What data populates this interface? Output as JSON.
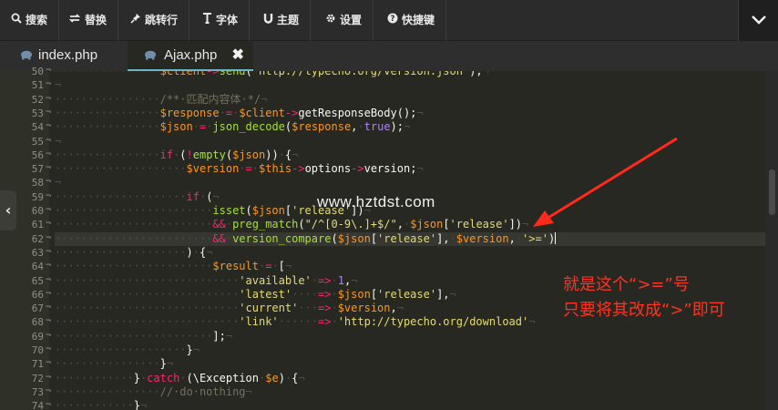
{
  "toolbar": {
    "buttons": [
      {
        "id": "search",
        "icon": "search-icon",
        "label": "搜索"
      },
      {
        "id": "replace",
        "icon": "replace-icon",
        "label": "替换"
      },
      {
        "id": "goto",
        "icon": "pin-icon",
        "label": "跳转行"
      },
      {
        "id": "font",
        "icon": "text-icon",
        "label": "字体"
      },
      {
        "id": "theme",
        "icon": "magnet-icon",
        "label": "主题"
      },
      {
        "id": "settings",
        "icon": "gear-icon",
        "label": "设置"
      },
      {
        "id": "shortcuts",
        "icon": "help-icon",
        "label": "快捷键"
      }
    ]
  },
  "tabs": [
    {
      "label": "index.php",
      "active": false
    },
    {
      "label": "Ajax.php",
      "active": true,
      "close": "✖"
    }
  ],
  "line_numbers": [
    "50",
    "51",
    "52",
    "53",
    "54",
    "55",
    "56",
    "57",
    "58",
    "59",
    "60",
    "61",
    "62",
    "63",
    "64",
    "65",
    "66",
    "67",
    "68",
    "69",
    "70",
    "71",
    "72",
    "73",
    "74"
  ],
  "annotations": {
    "watermark": "www.hztdst.com",
    "note_line1": "就是这个“>=”号",
    "note_line2": "只要将其改成“>”即可"
  },
  "colors": {
    "background": "#272822",
    "keyword": "#f92672",
    "function": "#a6e22e",
    "variable": "#fd971f",
    "string": "#e6db74",
    "number": "#ae81ff",
    "comment": "#75715e",
    "annotation": "#ff3322",
    "tab_underline": "#6bb7c9"
  }
}
